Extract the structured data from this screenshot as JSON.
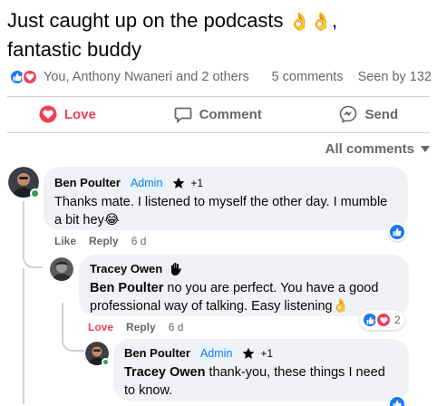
{
  "post": {
    "text": "Just caught up on the podcasts ",
    "emoji_1": "👌",
    "emoji_2": "👌",
    "text_end": ",",
    "text_line2": "fantastic buddy"
  },
  "stats": {
    "reactors": "You, Anthony Nwaneri and 2 others",
    "comments": "5 comments",
    "seen": "Seen by 132"
  },
  "actions": {
    "love": "Love",
    "comment": "Comment",
    "send": "Send"
  },
  "all_comments_label": "All comments",
  "colors": {
    "like_blue": "#1877f2",
    "love_red": "#f33e58",
    "bubble_bg": "#f0f2f5",
    "online_green": "#31a24c"
  },
  "comments": [
    {
      "author": "Ben Poulter",
      "badge": "Admin",
      "badge_count": "+1",
      "text": "Thanks mate. I listened to myself the other day. I mumble a bit hey",
      "emoji": "😂",
      "like_label": "Like",
      "reply_label": "Reply",
      "time": "6 d"
    },
    {
      "author": "Tracey Owen",
      "mention": "Ben Poulter",
      "text": " no you are perfect. You have a good professional way of talking. Easy listening",
      "emoji": "👌",
      "like_label": "Love",
      "reply_label": "Reply",
      "time": "6 d",
      "reaction_count": "2"
    },
    {
      "author": "Ben Poulter",
      "badge": "Admin",
      "badge_count": "+1",
      "mention": "Tracey Owen",
      "text": " thank-you, these things I need to know."
    }
  ]
}
